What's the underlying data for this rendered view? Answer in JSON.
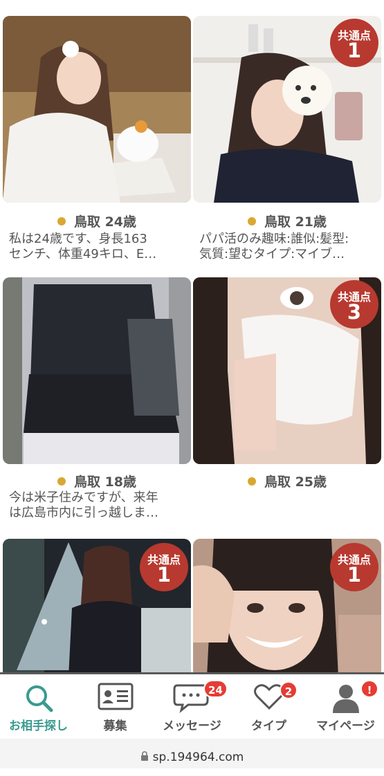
{
  "cards": [
    {
      "location": "鳥取 24歳",
      "description_1": "私は24歳です、身長163",
      "description_2": "センチ、体重49キロ、E…",
      "badge": null
    },
    {
      "location": "鳥取 21歳",
      "description_1": "パパ活のみ趣味:誰似:髪型:",
      "description_2": "気質:望むタイプ:マイブ…",
      "badge": {
        "label": "共通点",
        "count": "1"
      }
    },
    {
      "location": "鳥取 18歳",
      "description_1": "今は米子住みですが、来年",
      "description_2": "は広島市内に引っ越しま…",
      "badge": null
    },
    {
      "location": "鳥取 25歳",
      "description_1": "",
      "description_2": "",
      "badge": {
        "label": "共通点",
        "count": "3"
      }
    },
    {
      "location": "",
      "description_1": "",
      "description_2": "",
      "badge": {
        "label": "共通点",
        "count": "1"
      }
    },
    {
      "location": "",
      "description_1": "",
      "description_2": "",
      "badge": {
        "label": "共通点",
        "count": "1"
      }
    }
  ],
  "tabs": [
    {
      "label": "お相手探し",
      "icon": "search-icon",
      "active": true
    },
    {
      "label": "募集",
      "icon": "id-card-icon",
      "active": false
    },
    {
      "label": "メッセージ",
      "icon": "chat-icon",
      "badge": "24"
    },
    {
      "label": "タイプ",
      "icon": "heart-icon",
      "badge": "2"
    },
    {
      "label": "マイページ",
      "icon": "user-icon",
      "badge": "!"
    }
  ],
  "url": "sp.194964.com",
  "colors": {
    "badge_red": "#b8392f",
    "accent_teal": "#3a9a8f",
    "dot_gold": "#d9a832",
    "notify_red": "#e53c34"
  }
}
